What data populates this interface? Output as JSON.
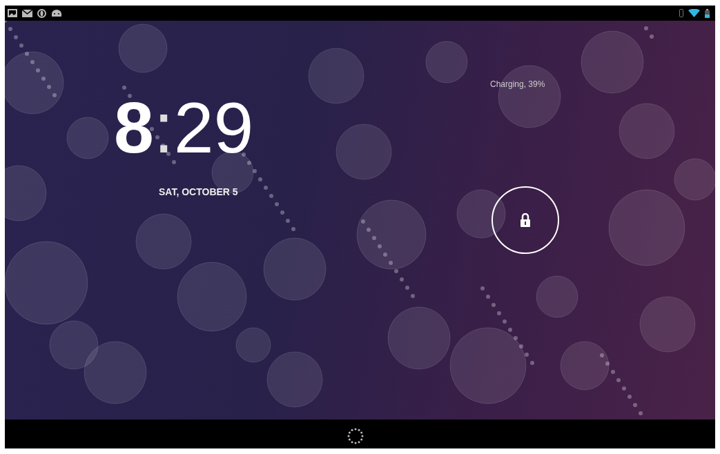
{
  "clock": {
    "hours": "8",
    "separator": ":",
    "minutes": "29"
  },
  "date": "SAT, OCTOBER 5",
  "charging_status": "Charging, 39%"
}
